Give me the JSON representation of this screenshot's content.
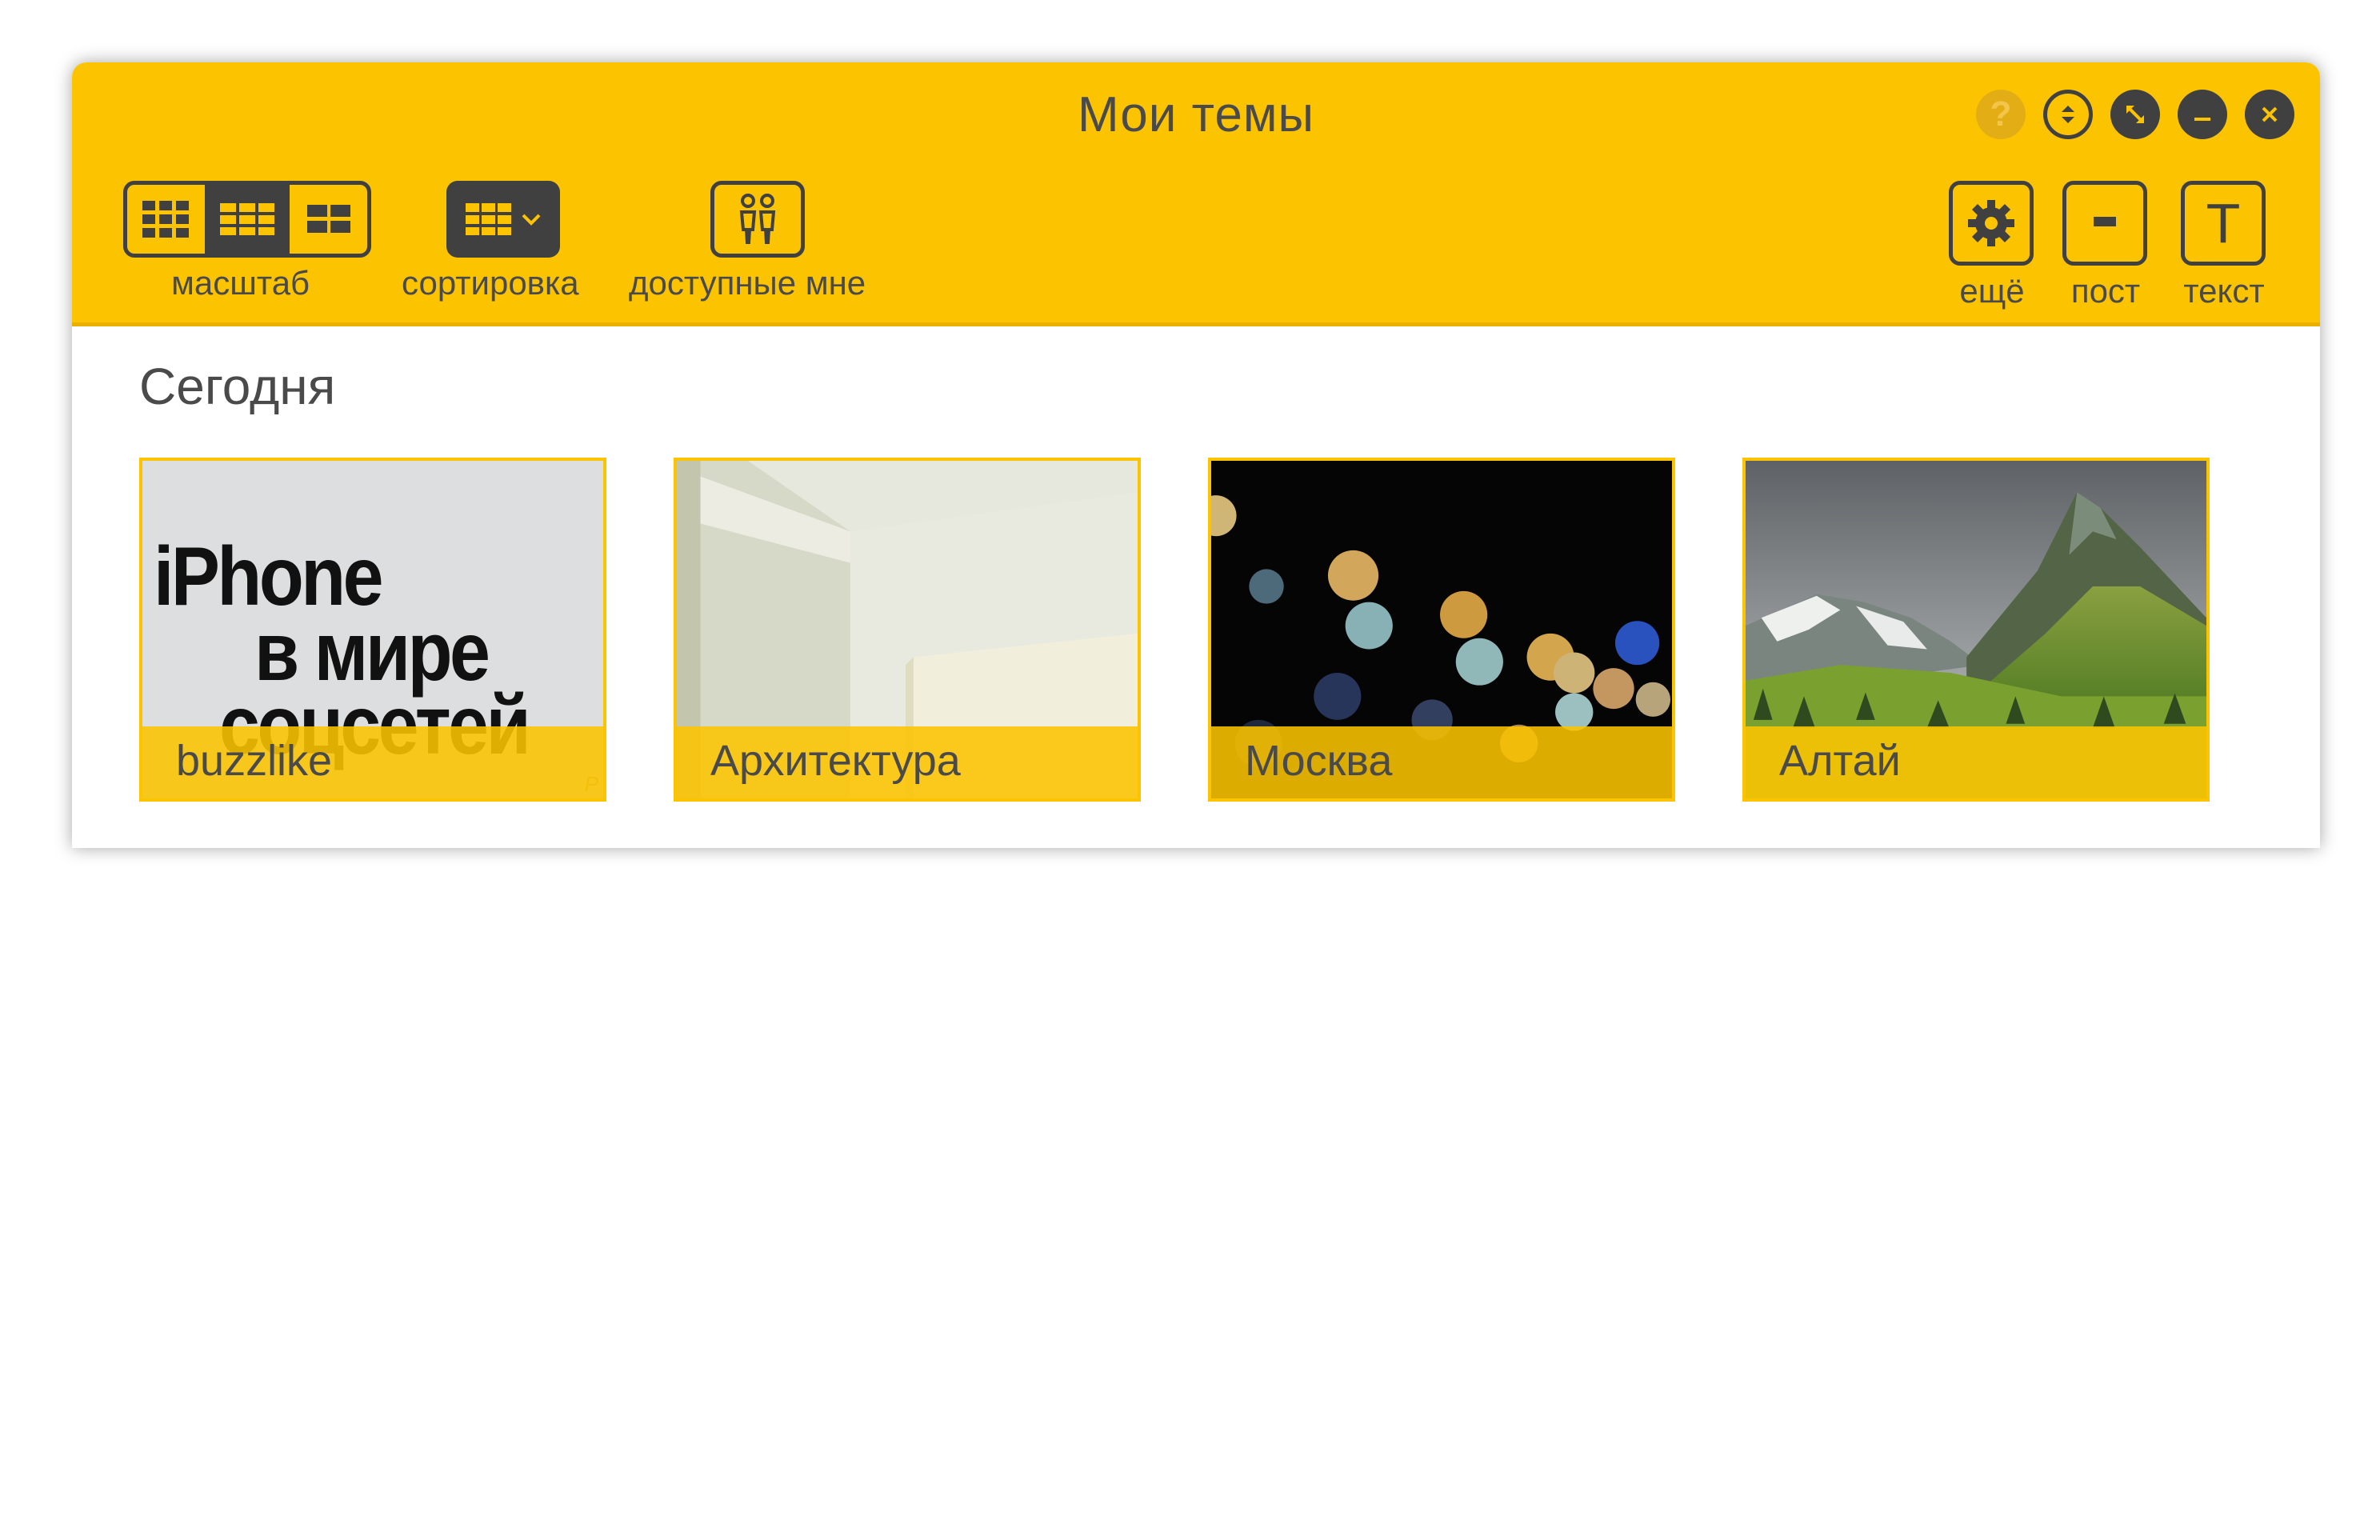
{
  "window": {
    "title": "Мои темы",
    "help_glyph": "?"
  },
  "toolbar": {
    "scale_label": "масштаб",
    "sort_label": "сортировка",
    "shared_label": "доступные мне",
    "more_label": "ещё",
    "post_label": "пост",
    "text_label": "текст",
    "text_icon_glyph": "T"
  },
  "section": {
    "title": "Сегодня"
  },
  "tiles": [
    {
      "caption": "buzzlike",
      "thumb_lines": [
        "iPhone",
        "в мире",
        "соцсетей"
      ],
      "thumb_mark": "P"
    },
    {
      "caption": "Архитектура"
    },
    {
      "caption": "Москва"
    },
    {
      "caption": "Алтай"
    }
  ],
  "colors": {
    "accent": "#fcc400",
    "dark": "#404040",
    "text": "#4a4a4a"
  },
  "icons": {
    "window_controls": [
      "help-icon",
      "collapse-expand-icon",
      "fullscreen-icon",
      "minimize-icon",
      "close-icon"
    ],
    "toolbar": [
      "grid-small-icon",
      "grid-medium-icon",
      "grid-large-icon",
      "sort-grid-icon",
      "chevron-down-icon",
      "users-icon",
      "gear-icon",
      "post-icon",
      "text-icon"
    ]
  }
}
